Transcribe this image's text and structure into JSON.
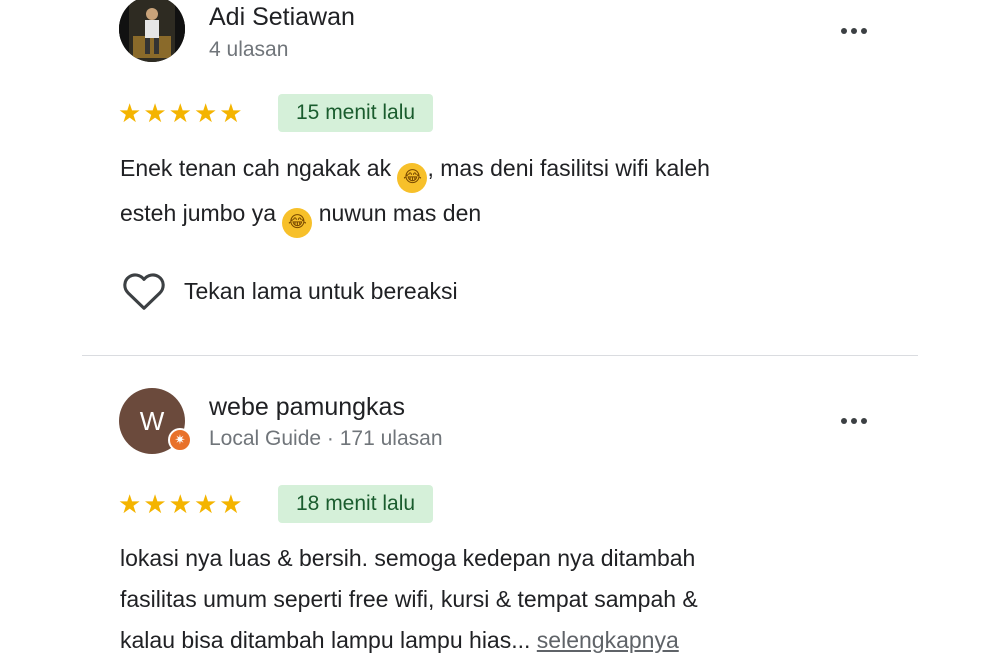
{
  "reviews": [
    {
      "author": "Adi Setiawan",
      "meta": "4 ulasan",
      "avatar": {
        "type": "photo"
      },
      "rating": 5,
      "time": "15 menit lalu",
      "text_line1_a": "Enek tenan cah ngakak ak",
      "text_line1_b": ", mas  deni fasilitsi wifi kaleh",
      "text_line2_a": "esteh jumbo ya",
      "text_line2_b": " nuwun mas den",
      "emoji": "rolling-on-floor-laughing",
      "react_label": "Tekan lama untuk bereaksi"
    },
    {
      "author": "webe pamungkas",
      "meta": "Local Guide · 171 ulasan",
      "avatar": {
        "type": "letter",
        "letter": "W",
        "color": "#6b4a3c"
      },
      "badge": "local-guide",
      "rating": 5,
      "time": "18 menit lalu",
      "text_lines": [
        "lokasi nya luas & bersih. semoga kedepan nya ditambah",
        "fasilitas umum seperti free wifi, kursi & tempat sampah &",
        "kalau bisa ditambah lampu lampu hias... "
      ],
      "more_label": "selengkapnya"
    }
  ],
  "colors": {
    "star": "#f4b400",
    "time_badge_bg": "#d5f0d9",
    "guide_badge": "#e8712a"
  }
}
